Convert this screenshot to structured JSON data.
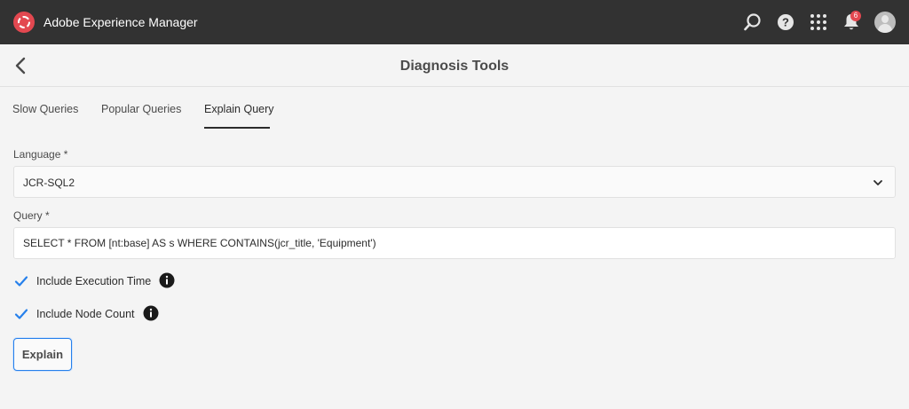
{
  "app": {
    "name": "Adobe Experience Manager",
    "notification_count": "6",
    "icons": [
      "search-icon",
      "help-icon",
      "apps-grid-icon",
      "bell-icon",
      "user-avatar"
    ]
  },
  "page": {
    "title": "Diagnosis Tools"
  },
  "tabs": [
    {
      "label": "Slow Queries",
      "active": false
    },
    {
      "label": "Popular Queries",
      "active": false
    },
    {
      "label": "Explain Query",
      "active": true
    }
  ],
  "form": {
    "language_label": "Language *",
    "language_value": "JCR-SQL2",
    "query_label": "Query *",
    "query_value": "SELECT * FROM [nt:base] AS s WHERE CONTAINS(jcr_title, 'Equipment')",
    "include_execution_time_label": "Include Execution Time",
    "include_execution_time_checked": true,
    "include_node_count_label": "Include Node Count",
    "include_node_count_checked": true,
    "explain_button_label": "Explain"
  },
  "colors": {
    "shell_bg": "#323232",
    "accent": "#2680eb",
    "brand_red": "#e34850",
    "page_bg": "#f4f4f4"
  }
}
